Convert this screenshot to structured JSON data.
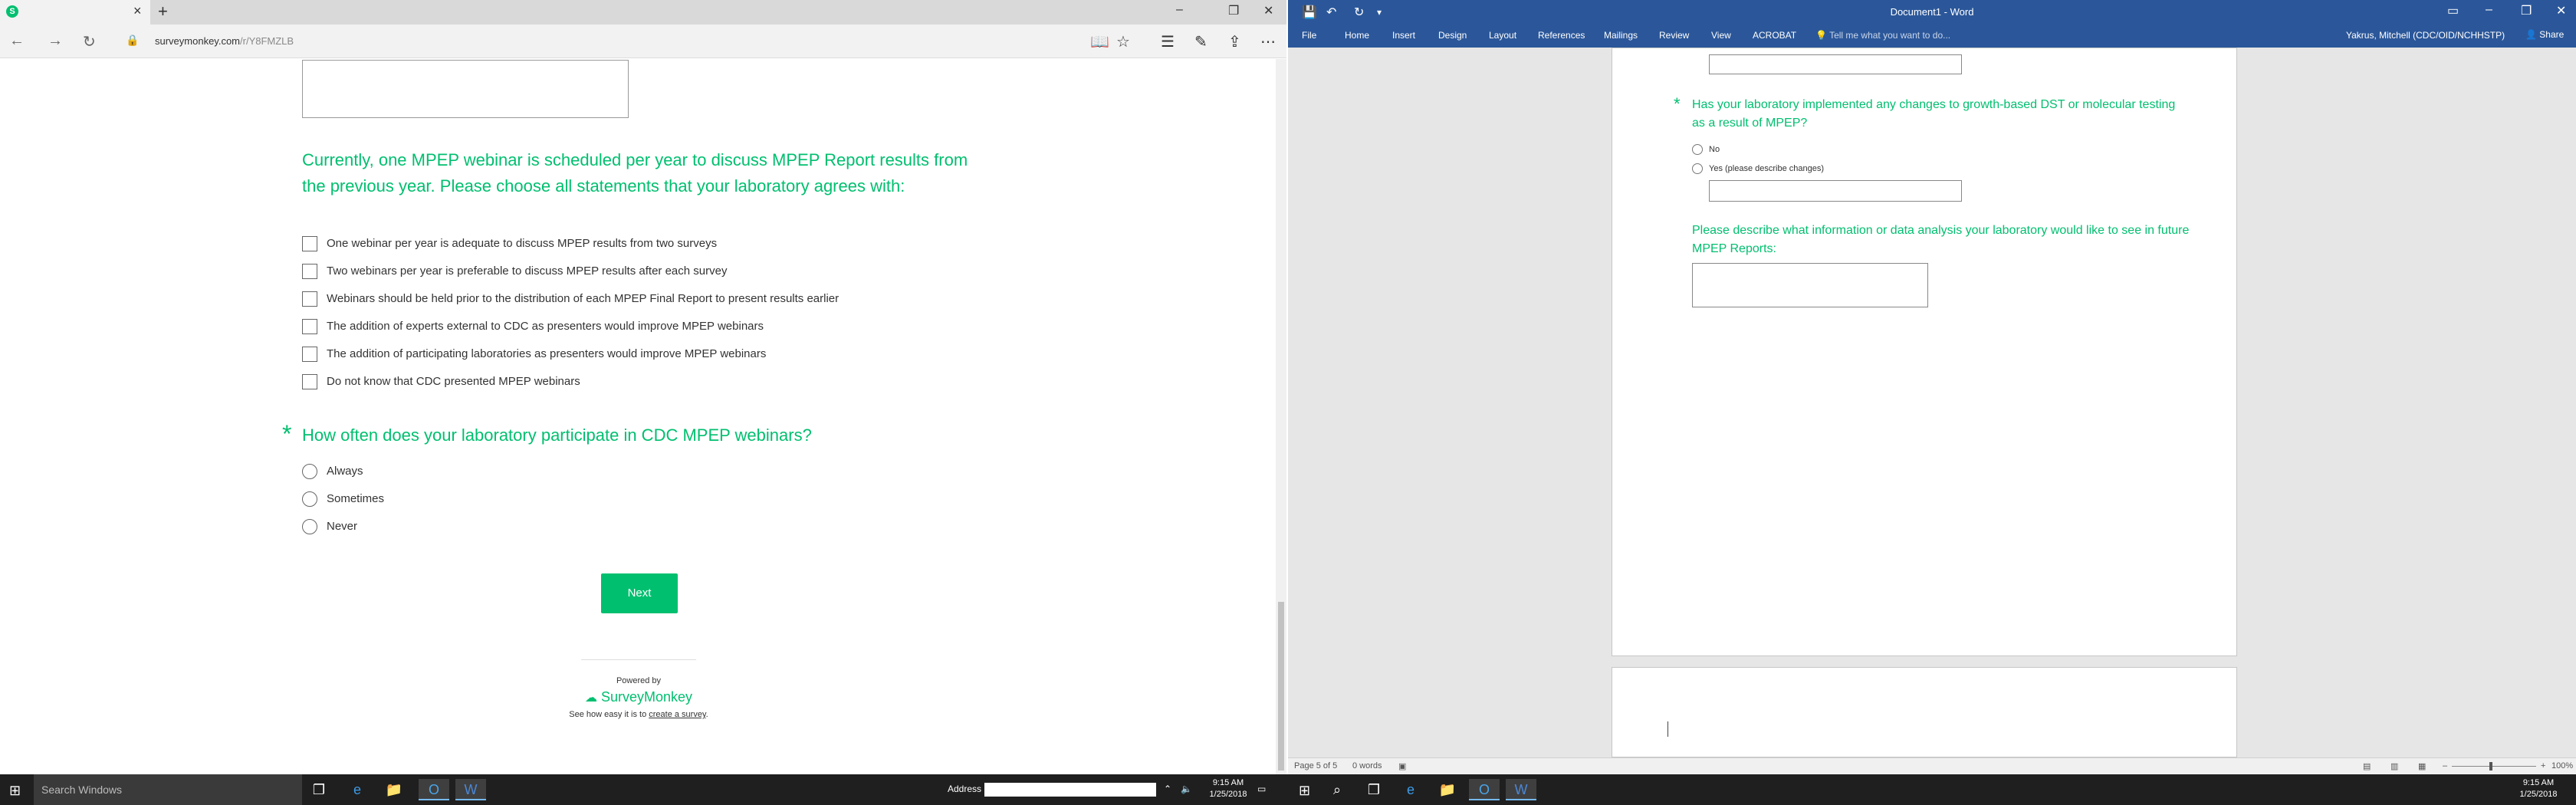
{
  "edge": {
    "tab": {
      "favicon": "surveymonkey-icon",
      "favicon_glyph": "S"
    },
    "url": {
      "host": "surveymonkey.com",
      "path": "/r/Y8FMZLB"
    },
    "survey": {
      "q_statements": "Currently, one MPEP webinar is scheduled per year to discuss MPEP Report results from the previous year. Please choose all statements that your laboratory agrees with:",
      "options": [
        "One webinar per year is adequate to discuss MPEP results from two surveys",
        "Two webinars per year is preferable to discuss MPEP results after each survey",
        "Webinars should be held prior to the distribution of each MPEP Final Report to present results earlier",
        "The addition of experts external to CDC as presenters would improve MPEP webinars",
        "The addition of participating laboratories as presenters would improve MPEP webinars",
        "Do not know that CDC presented MPEP webinars"
      ],
      "q_frequency": "How often does your laboratory participate in CDC MPEP webinars?",
      "asterisk": "*",
      "frequency_options": [
        "Always",
        "Sometimes",
        "Never"
      ],
      "next_label": "Next",
      "powered_by": "Powered by",
      "brand": "SurveyMonkey",
      "tagline_prefix": "See how easy it is to ",
      "tagline_link": "create a survey",
      "tagline_suffix": "."
    }
  },
  "word": {
    "title": "Document1 - Word",
    "tabs": [
      "File",
      "Home",
      "Insert",
      "Design",
      "Layout",
      "References",
      "Mailings",
      "Review",
      "View",
      "ACROBAT"
    ],
    "tell_me": "Tell me what you want to do...",
    "user": "Yakrus, Mitchell (CDC/OID/NCHHSTP)",
    "share": "Share",
    "doc": {
      "q_changes": "Has your laboratory implemented any changes to growth-based DST or molecular testing as a result of MPEP?",
      "asterisk": "*",
      "options": [
        "No",
        "Yes (please describe changes)"
      ],
      "q_describe": "Please describe what information or data analysis your laboratory would like to see in future MPEP Reports:"
    },
    "status": {
      "page": "Page 5 of 5",
      "words": "0 words",
      "zoom": "100%"
    }
  },
  "taskbar": {
    "search_placeholder": "Search Windows",
    "address_label": "Address",
    "time": "9:15 AM",
    "date": "1/25/2018"
  },
  "colors": {
    "accent_green": "#00bf6f",
    "word_blue": "#2b579a"
  }
}
